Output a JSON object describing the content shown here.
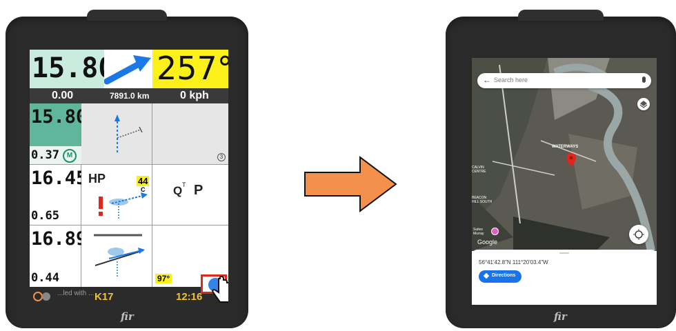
{
  "left_device": {
    "top_left_value": "15.80",
    "top_right_heading": "257°",
    "stats": {
      "distance_left": "0.00",
      "distance": "7891.0 km",
      "speed": "0 kph"
    },
    "rows": [
      {
        "value": "15.80",
        "sub": "0.37",
        "badge": "M"
      },
      {
        "value": "16.45",
        "sub": "0.65"
      },
      {
        "value": "16.89",
        "sub": "0.44"
      }
    ],
    "hp_label": "HP",
    "hp_number": "44",
    "hp_sub": "C",
    "qt_label": "Q",
    "qt_sup": "T",
    "p_label": "P",
    "circle_number": "3",
    "bottom_temp": "97°",
    "bottom_bar": {
      "k_label": "K17",
      "time": "12:16",
      "toast": "...led with ..."
    },
    "brand": "fir"
  },
  "right_device": {
    "search_placeholder": "Search here",
    "map_label_waterways": "WATERWAYS",
    "map_label_beacon": "BEACON HILL SOUTH",
    "map_label_centre": "CALVIN CENTRE",
    "map_label_suites": "Suites Murray",
    "google_label": "Google",
    "coordinates": "56°41'42.8\"N 111°20'03.4\"W",
    "directions_label": "Directions",
    "brand": "fir"
  },
  "colors": {
    "mint": "#c9ecdf",
    "yellow": "#fbf01a",
    "blue": "#1c78e6",
    "arrow": "#f3914c",
    "red": "#e0271d"
  }
}
